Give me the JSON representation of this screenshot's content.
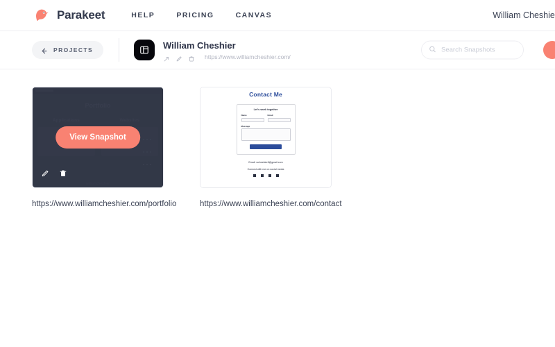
{
  "topnav": {
    "brand": "Parakeet",
    "logo_icon": "bird-logo-icon",
    "links": [
      {
        "label": "HELP"
      },
      {
        "label": "PRICING"
      },
      {
        "label": "CANVAS"
      }
    ],
    "user": "William Cheshier"
  },
  "subheader": {
    "back_button": {
      "label": "PROJECTS",
      "icon": "arrow-left-icon"
    },
    "project_icon": "layout-panel-icon",
    "project_title": "William Cheshier",
    "project_url": "https://www.williamcheshier.com/",
    "actions": [
      {
        "icon": "share-icon"
      },
      {
        "icon": "pencil-icon"
      },
      {
        "icon": "trash-icon"
      }
    ],
    "search": {
      "placeholder": "Search Snapshots",
      "value": "",
      "icon": "search-icon"
    },
    "add_button": {
      "icon": "plus-icon"
    }
  },
  "snapshots": [
    {
      "url": "https://www.williamcheshier.com/portfolio",
      "hovered": true,
      "overlay": {
        "view_label": "View Snapshot",
        "edit_icon": "pencil-icon",
        "delete_icon": "trash-icon"
      },
      "preview": {
        "kind": "portfolio-dark",
        "title": "Portfolio",
        "columns": [
          "Applications",
          "Websites"
        ],
        "footer": "williamcheshier"
      }
    },
    {
      "url": "https://www.williamcheshier.com/contact",
      "hovered": false,
      "preview": {
        "kind": "contact-light",
        "title": "Contact Me",
        "form_title": "Let's work together",
        "fields": [
          {
            "label": "Name",
            "placeholder": "Name"
          },
          {
            "label": "Email",
            "placeholder": "Email"
          }
        ],
        "message_label": "Message",
        "message_placeholder": "Message",
        "submit_label": "Submit",
        "email_line": "Email: wcheshier8@gmail.com",
        "social_line": "Connect with me on social media",
        "socials": [
          "instagram-icon",
          "facebook-icon",
          "linkedin-icon",
          "twitter-icon"
        ]
      }
    }
  ],
  "colors": {
    "accent": "#f98272",
    "ink": "#3d4456",
    "dark_preview": "#3e4455",
    "contact_blue": "#2b4c9b"
  }
}
